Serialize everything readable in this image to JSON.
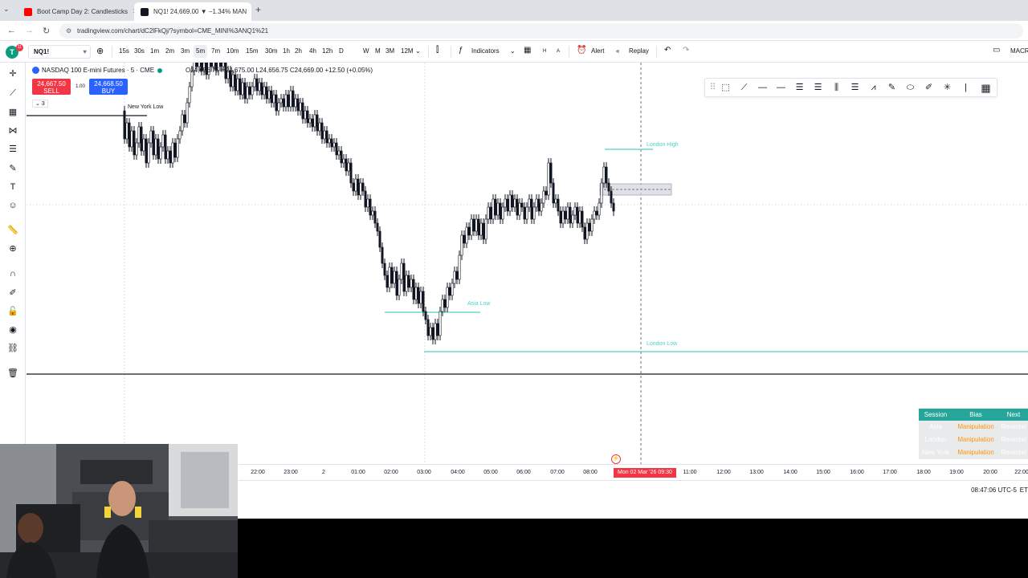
{
  "browser": {
    "tabs": [
      {
        "title": "Boot Camp Day 2: Candlesticks",
        "favicon_color": "#ff0000",
        "active": false
      },
      {
        "title": "NQ1! 24,669.00 ▼ −1.34% MAN",
        "favicon_color": "#131722",
        "active": true
      }
    ],
    "url": "tradingview.com/chart/dC2lFkQj/?symbol=CME_MINI%3ANQ1%21"
  },
  "toolbar": {
    "avatar_letter": "T",
    "avatar_badge": "11",
    "symbol": "NQ1!",
    "timeframes": [
      "15s",
      "30s",
      "1m",
      "2m",
      "3m",
      "5m",
      "7m",
      "10m",
      "15m",
      "30m",
      "1h",
      "2h",
      "4h",
      "12h",
      "D",
      "W",
      "M",
      "3M",
      "12M"
    ],
    "selected_timeframe": "5m",
    "indicators_label": "Indicators",
    "alert_label": "Alert",
    "replay_label": "Replay",
    "right_label": "MACR",
    "mini_h": "H",
    "mini_a": "A"
  },
  "chart": {
    "title": "NASDAQ 100 E-mini Futures · 5 · CME",
    "ohlc": "O24,656.75  H24,675.00  L24,656.75  C24,669.00  +12.50 (+0.05%)",
    "sell_price": "24,667.50",
    "sell_label": "SELL",
    "buy_price": "24,668.50",
    "buy_label": "BUY",
    "quantity": "1.00",
    "indicator_count": "3",
    "annotations": {
      "new_york_low": "New York Low",
      "london_high": "London High",
      "asia_low": "Asia Low",
      "london_low": "London Low"
    },
    "colors": {
      "level_line": "#4dd0c8",
      "up_candle": "#ffffff",
      "down_candle": "#131722",
      "accent_red": "#f23645",
      "accent_blue": "#2962ff",
      "table_header": "#26a69a",
      "bias_text": "#ff9800"
    }
  },
  "session_table": {
    "headers": [
      "Session",
      "Bias",
      "Next"
    ],
    "rows": [
      {
        "session": "Asia",
        "bias": "Manipulation",
        "next": "Reversal"
      },
      {
        "session": "London",
        "bias": "Manipulation",
        "next": "Reversal"
      },
      {
        "session": "New York",
        "bias": "Manipulation",
        "next": "Reversal"
      }
    ]
  },
  "time_axis": {
    "ticks": [
      "22:00",
      "23:00",
      "2",
      "01:00",
      "02:00",
      "03:00",
      "04:00",
      "05:00",
      "06:00",
      "07:00",
      "08:00",
      "11:00",
      "12:00",
      "13:00",
      "14:00",
      "15:00",
      "16:00",
      "17:00",
      "18:00",
      "19:00",
      "20:00",
      "21:00",
      "22:00"
    ],
    "cursor_label": "Mon 02 Mar '26   09:30",
    "clock": "08:47:06 UTC-5",
    "clock_suffix": "ET"
  }
}
